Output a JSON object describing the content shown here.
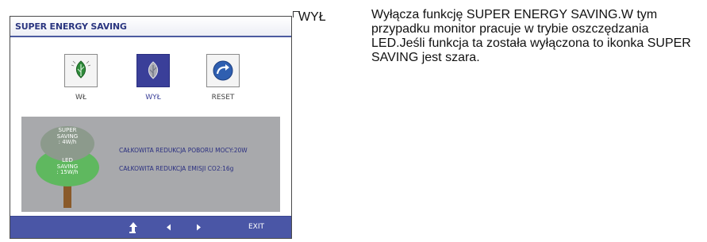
{
  "osd": {
    "title": "SUPER ENERGY SAVING",
    "options": [
      {
        "label": "WŁ",
        "icon": "leaf-icon",
        "selected": false
      },
      {
        "label": "WYŁ",
        "icon": "leaf-icon",
        "selected": true
      },
      {
        "label": "RESET",
        "icon": "reset-arrow-icon",
        "selected": false
      }
    ],
    "tree": {
      "super_line1": "SUPER",
      "super_line2": "SAVING",
      "super_value": ": 4W/h",
      "led_line1": "LED",
      "led_line2": "SAVING",
      "led_value": ": 15W/h"
    },
    "stats": {
      "power_reduction": "CAŁKOWITA REDUKCJA POBORU MOCY:20W",
      "co2_reduction": "CAŁKOWITA REDUKCJA EMISJI CO2:16g"
    },
    "nav": {
      "icons": [
        "up-arrow-icon",
        "left-arrow-icon",
        "right-arrow-icon"
      ],
      "exit_label": "EXIT"
    }
  },
  "explanation": {
    "label": "WYŁ",
    "text": "Wyłącza funkcję SUPER ENERGY SAVING.W tym przypadku monitor pracuje w trybie oszczędzania LED.Jeśli funkcja ta została wyłączona to ikonka SUPER SAVING jest szara."
  },
  "colors": {
    "accent": "#3a3f99",
    "nav_bar": "#4a56a6",
    "panel_gray": "#a8a9ac",
    "led_green": "#5fb85f",
    "super_gray": "#8c9a8c"
  }
}
